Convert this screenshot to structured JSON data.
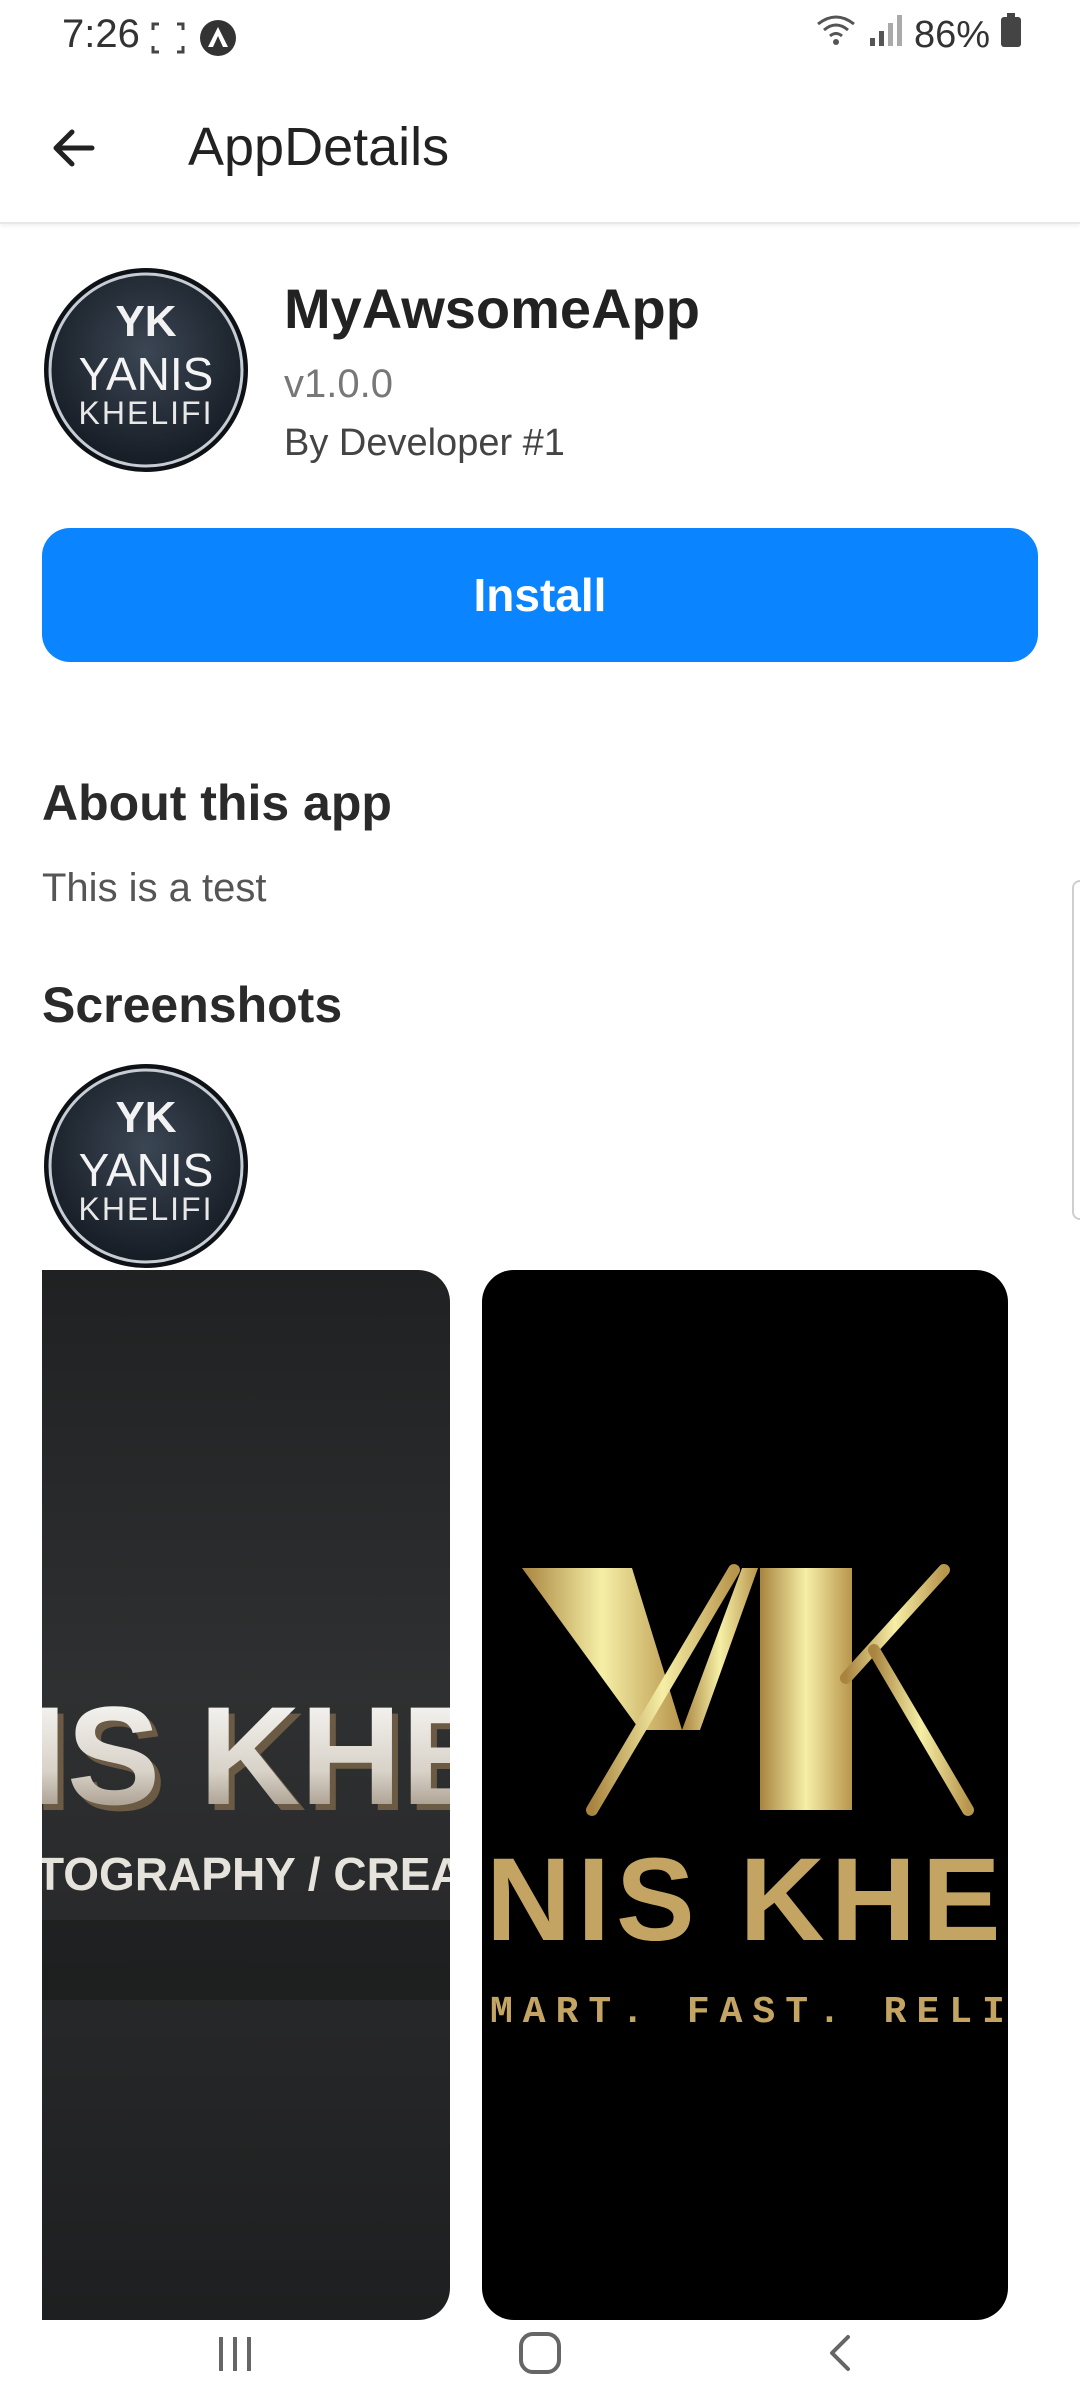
{
  "status_bar": {
    "time": "7:26",
    "battery": "86%"
  },
  "app_bar": {
    "title": "AppDetails"
  },
  "app": {
    "name": "MyAwsomeApp",
    "version": "v1.0.0",
    "developer": "By Developer #1",
    "logo_text": {
      "monogram": "YK",
      "line1": "YANIS",
      "line2": "KHELIFI"
    }
  },
  "install": {
    "label": "Install",
    "color": "#0a84ff"
  },
  "about": {
    "title": "About this app",
    "text": "This is a test"
  },
  "screenshots": {
    "title": "Screenshots",
    "items": [
      {
        "headline": "IS KHEI",
        "subline": "TOGRAPHY / CREATIV"
      },
      {
        "monogram": "YK",
        "headline": "NIS KHELI",
        "subline": "MART. FAST. RELIABLE"
      }
    ]
  },
  "icons": [
    "screenshot-icon",
    "android-auto-icon",
    "wifi-icon",
    "signal-icon",
    "battery-icon",
    "back-arrow-icon",
    "recent-apps-icon",
    "home-icon",
    "nav-back-icon"
  ]
}
